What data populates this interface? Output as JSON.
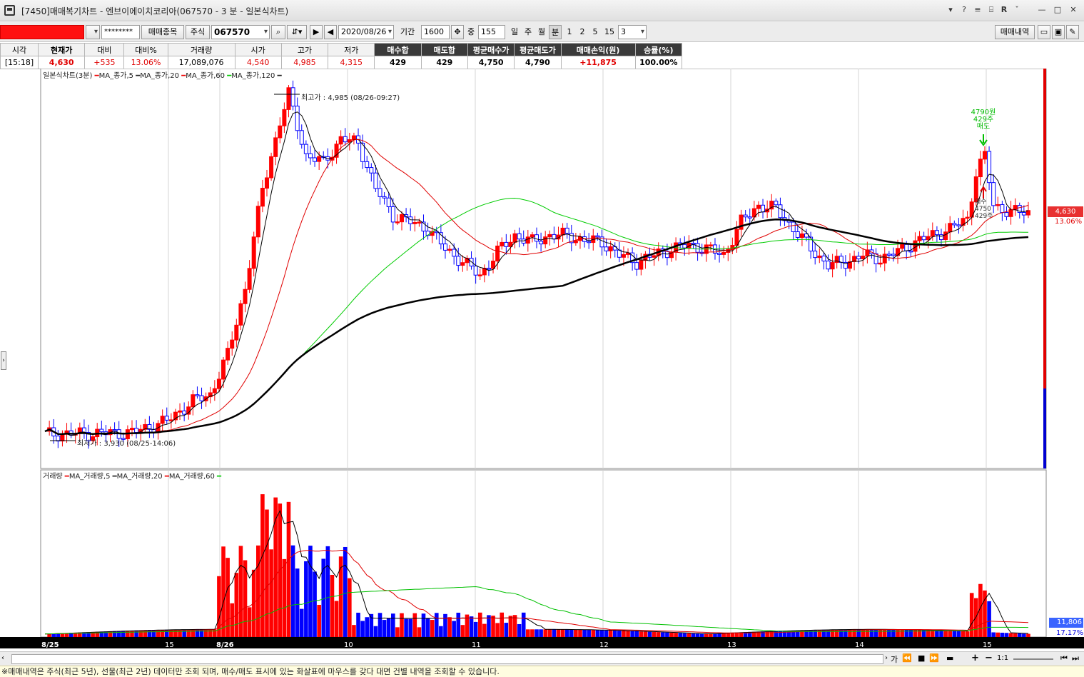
{
  "window": {
    "title": "[7450]매매복기차트 - 엔브이에이치코리아(067570 - 3 분 - 일본식차트)",
    "buttons": [
      "▾",
      "?",
      "≡",
      "⌸",
      "R",
      "ˇ",
      "—",
      "□",
      "✕"
    ]
  },
  "toolbar": {
    "account_value": "",
    "password_mask": "********",
    "trade_items_button": "매매종목",
    "market_type": "주식",
    "code_value": "067570",
    "date_value": "2020/08/26",
    "period_label": "기간",
    "period_value": "1600",
    "count_label": "중",
    "count_value": "155",
    "timeframes": [
      "일",
      "주",
      "월",
      "분"
    ],
    "active_timeframe": "분",
    "intervals": [
      "1",
      "2",
      "5",
      "15"
    ],
    "interval_select": "3",
    "trade_history_button": "매매내역"
  },
  "info": {
    "headers": [
      "시각",
      "현재가",
      "대비",
      "대비%",
      "거래량",
      "시가",
      "고가",
      "저가",
      "매수합",
      "매도합",
      "평균매수가",
      "평균매도가",
      "매매손익(원)",
      "승률(%)"
    ],
    "values": [
      "[15:18]",
      "4,630",
      "+535",
      "13.06%",
      "17,089,076",
      "4,540",
      "4,985",
      "4,315",
      "429",
      "429",
      "4,750",
      "4,790",
      "+11,875",
      "100.00%"
    ]
  },
  "chart": {
    "price_legend": {
      "title": "일본식차트(3분)",
      "mas": [
        "MA_종가,5",
        "MA_종가,20",
        "MA_종가,60",
        "MA_종가,120"
      ]
    },
    "volume_legend": {
      "title": "거래량",
      "mas": [
        "MA_거래량,5",
        "MA_거래량,20",
        "MA_거래량,60"
      ]
    },
    "high_annotation": "최고가 : 4,985 (08/26-09:27)",
    "low_annotation": "최저가 : 3,930 (08/25-14:06)",
    "trade_marker": [
      "4790원",
      "429주",
      "매도"
    ],
    "buy_marker": [
      "매수",
      "4750",
      "429주"
    ],
    "price_badge": "4,630",
    "price_pct": "13.06%",
    "volume_badge": "11,806",
    "volume_pct": "17.17%",
    "x_labels": [
      "8/25",
      "15",
      "8/26",
      "10",
      "11",
      "12",
      "13",
      "14",
      "15"
    ],
    "colors": {
      "up": "#ff0000",
      "down": "#0000ff",
      "ma5": "#000000",
      "ma20": "#e00000",
      "ma60": "#00cc00",
      "ma120": "#000000"
    }
  },
  "scroll": {
    "controls": [
      "가",
      "⏪",
      "■",
      "⏩",
      "+",
      "−",
      "1:1"
    ]
  },
  "status": "※매매내역은 주식(최근 5년), 선물(최근 2년) 데이터만 조회 되며, 매수/매도 표시에 있는 화살표에 마우스를 갖다 대면 건별 내역을 조회할 수 있습니다."
}
